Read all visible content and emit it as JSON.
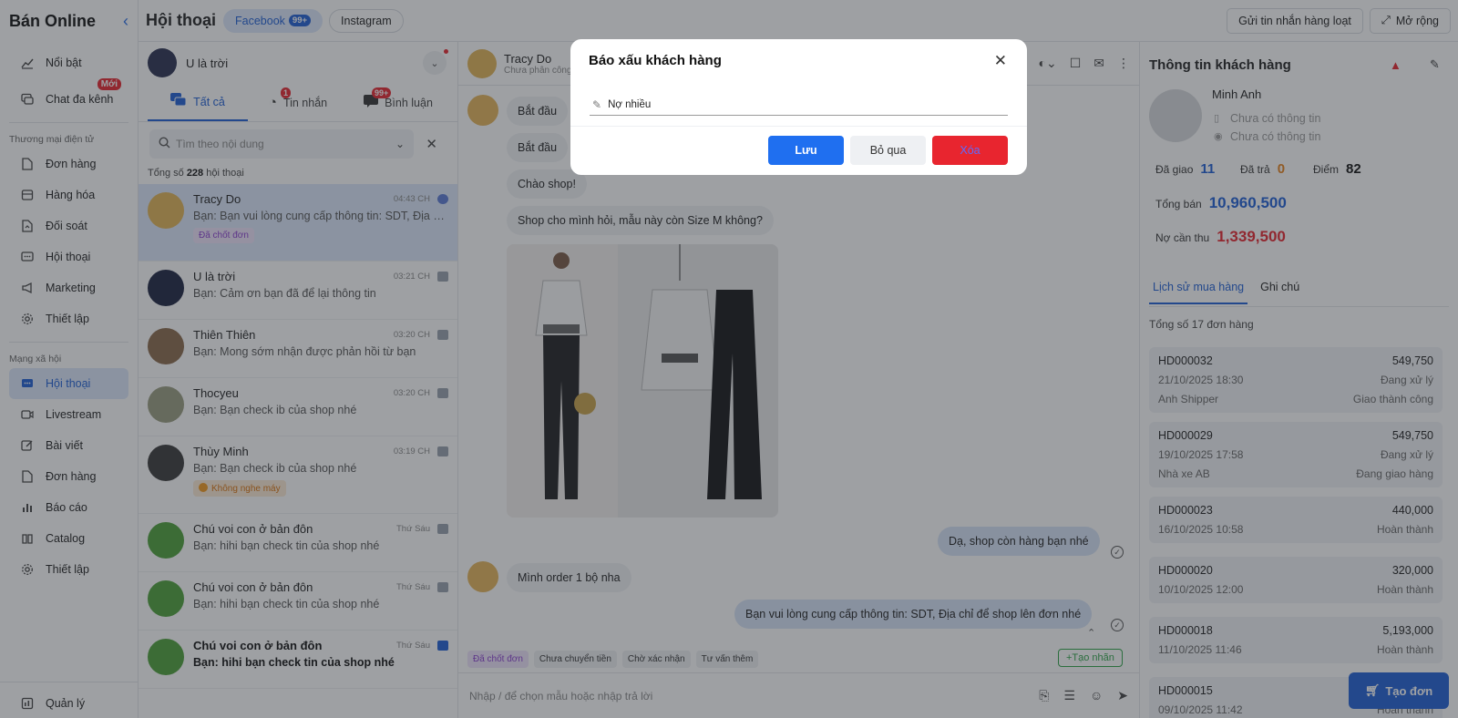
{
  "brand": {
    "title": "Bán Online"
  },
  "sidebar": {
    "top_items": [
      {
        "label": "Nổi bật",
        "icon": "chart-icon"
      },
      {
        "label": "Chat đa kênh",
        "icon": "chat-icon",
        "badge": "Mới"
      }
    ],
    "section_ecommerce": "Thương mại điện tử",
    "ecommerce_items": [
      {
        "label": "Đơn hàng",
        "icon": "file-icon"
      },
      {
        "label": "Hàng hóa",
        "icon": "box-icon"
      },
      {
        "label": "Đối soát",
        "icon": "reconcile-icon"
      },
      {
        "label": "Hội thoại",
        "icon": "message-icon"
      },
      {
        "label": "Marketing",
        "icon": "megaphone-icon"
      },
      {
        "label": "Thiết lập",
        "icon": "gear-icon"
      }
    ],
    "section_social": "Mạng xã hội",
    "social_items": [
      {
        "label": "Hội thoại",
        "icon": "message-icon",
        "active": true
      },
      {
        "label": "Livestream",
        "icon": "video-icon"
      },
      {
        "label": "Bài viết",
        "icon": "edit-icon"
      },
      {
        "label": "Đơn hàng",
        "icon": "file-icon"
      },
      {
        "label": "Báo cáo",
        "icon": "bar-chart-icon"
      },
      {
        "label": "Catalog",
        "icon": "catalog-icon"
      },
      {
        "label": "Thiết lập",
        "icon": "gear-icon"
      }
    ],
    "bottom_item": {
      "label": "Quản lý",
      "icon": "dashboard-icon"
    }
  },
  "topbar": {
    "title": "Hội thoại",
    "channels": [
      {
        "label": "Facebook",
        "count": "99+",
        "active": true
      },
      {
        "label": "Instagram"
      }
    ],
    "bulk_message": "Gửi tin nhắn hàng loạt",
    "expand": "Mở rộng"
  },
  "convlist": {
    "account_name": "U là trời",
    "tabs": [
      {
        "label": "Tất cả",
        "active": true
      },
      {
        "label": "Tin nhắn",
        "count": "1"
      },
      {
        "label": "Bình luận",
        "count": "99+"
      }
    ],
    "search_placeholder": "Tìm theo nội dung",
    "total_prefix": "Tổng số",
    "total_count": "228",
    "total_suffix": "hội thoại",
    "items": [
      {
        "name": "Tracy Do",
        "time": "04:43 CH",
        "message": "Bạn: Bạn vui lòng cung cấp thông tin: SDT, Địa chỉ để shop lên đơn nhé",
        "tag": "Đã chốt đơn",
        "channel": "messenger"
      },
      {
        "name": "U là trời",
        "time": "03:21 CH",
        "message": "Bạn: Cảm ơn bạn đã để lại thông tin",
        "channel": "comment"
      },
      {
        "name": "Thiên Thiên",
        "time": "03:20 CH",
        "message": "Bạn: Mong sớm nhận được phản hồi từ bạn",
        "channel": "comment"
      },
      {
        "name": "Thocyeu",
        "time": "03:20 CH",
        "message": "Bạn: Bạn check ib của shop nhé",
        "channel": "comment"
      },
      {
        "name": "Thùy Minh",
        "time": "03:19 CH",
        "message": "Bạn: Bạn check ib của shop nhé",
        "tag": "Không nghe máy",
        "channel": "comment"
      },
      {
        "name": "Chú voi con ở bản đôn",
        "time": "Thứ Sáu",
        "message": "Bạn: hihi bạn check tin của shop nhé",
        "channel": "comment"
      },
      {
        "name": "Chú voi con ở bản đôn",
        "time": "Thứ Sáu",
        "message": "Bạn: hihi bạn check tin của shop nhé",
        "channel": "comment"
      },
      {
        "name": "Chú voi con ở bản đôn",
        "time": "Thứ Sáu",
        "message": "Bạn: hihi bạn check tin của shop nhé",
        "channel": "comment-blue",
        "unread": true
      }
    ]
  },
  "chat": {
    "name": "Tracy Do",
    "subtitle": "Chưa phân công",
    "messages": [
      {
        "text": "Bắt đầu",
        "dir": "in"
      },
      {
        "text": "Bắt đầu",
        "dir": "in"
      },
      {
        "text": "Chào shop!",
        "dir": "in"
      },
      {
        "text": "Shop cho mình hỏi, mẫu này còn Size M không?",
        "dir": "in"
      },
      {
        "text": "Dạ, shop còn hàng bạn nhé",
        "dir": "out"
      },
      {
        "text": "Mình order 1 bộ nha",
        "dir": "in"
      },
      {
        "text": "Bạn vui lòng cung cấp thông tin: SDT, Địa chỉ để shop lên đơn nhé",
        "dir": "out"
      }
    ],
    "quick_tags": [
      "Đã chốt đơn",
      "Chưa chuyển tiền",
      "Chờ xác nhận",
      "Tư vấn thêm"
    ],
    "create_label": "+Tạo nhãn",
    "composer_placeholder": "Nhập / để chọn mẫu hoặc nhập trả lời"
  },
  "customer": {
    "heading": "Thông tin khách hàng",
    "name": "Minh Anh",
    "phone": "Chưa có thông tin",
    "address": "Chưa có thông tin",
    "delivered_label": "Đã giao",
    "delivered": "11",
    "returned_label": "Đã trả",
    "returned": "0",
    "points_label": "Điểm",
    "points": "82",
    "total_sales_label": "Tổng bán",
    "total_sales": "10,960,500",
    "debt_label": "Nợ cần thu",
    "debt": "1,339,500",
    "tabs": [
      {
        "label": "Lịch sử mua hàng",
        "active": true
      },
      {
        "label": "Ghi chú"
      }
    ],
    "orders_total": "Tổng số 17 đơn hàng",
    "orders": [
      {
        "code": "HD000032",
        "amount": "549,750",
        "date": "21/10/2025 18:30",
        "status": "Đang xử lý",
        "carrier": "Anh Shipper",
        "delivery": "Giao thành công"
      },
      {
        "code": "HD000029",
        "amount": "549,750",
        "date": "19/10/2025 17:58",
        "status": "Đang xử lý",
        "carrier": "Nhà xe AB",
        "delivery": "Đang giao hàng"
      },
      {
        "code": "HD000023",
        "amount": "440,000",
        "date": "16/10/2025 10:58",
        "status": "Hoàn thành"
      },
      {
        "code": "HD000020",
        "amount": "320,000",
        "date": "10/10/2025 12:00",
        "status": "Hoàn thành"
      },
      {
        "code": "HD000018",
        "amount": "5,193,000",
        "date": "11/10/2025 11:46",
        "status": "Hoàn thành"
      },
      {
        "code": "HD000015",
        "amount": "",
        "date": "09/10/2025 11:42",
        "status": "Hoàn thành"
      }
    ],
    "create_order": "Tạo đơn"
  },
  "modal": {
    "title": "Báo xấu khách hàng",
    "field_value": "Nợ nhiều",
    "save": "Lưu",
    "skip": "Bỏ qua",
    "delete": "Xóa"
  },
  "colors": {
    "primary": "#1f5fd6",
    "danger": "#e8252f",
    "success": "#2fa548"
  }
}
